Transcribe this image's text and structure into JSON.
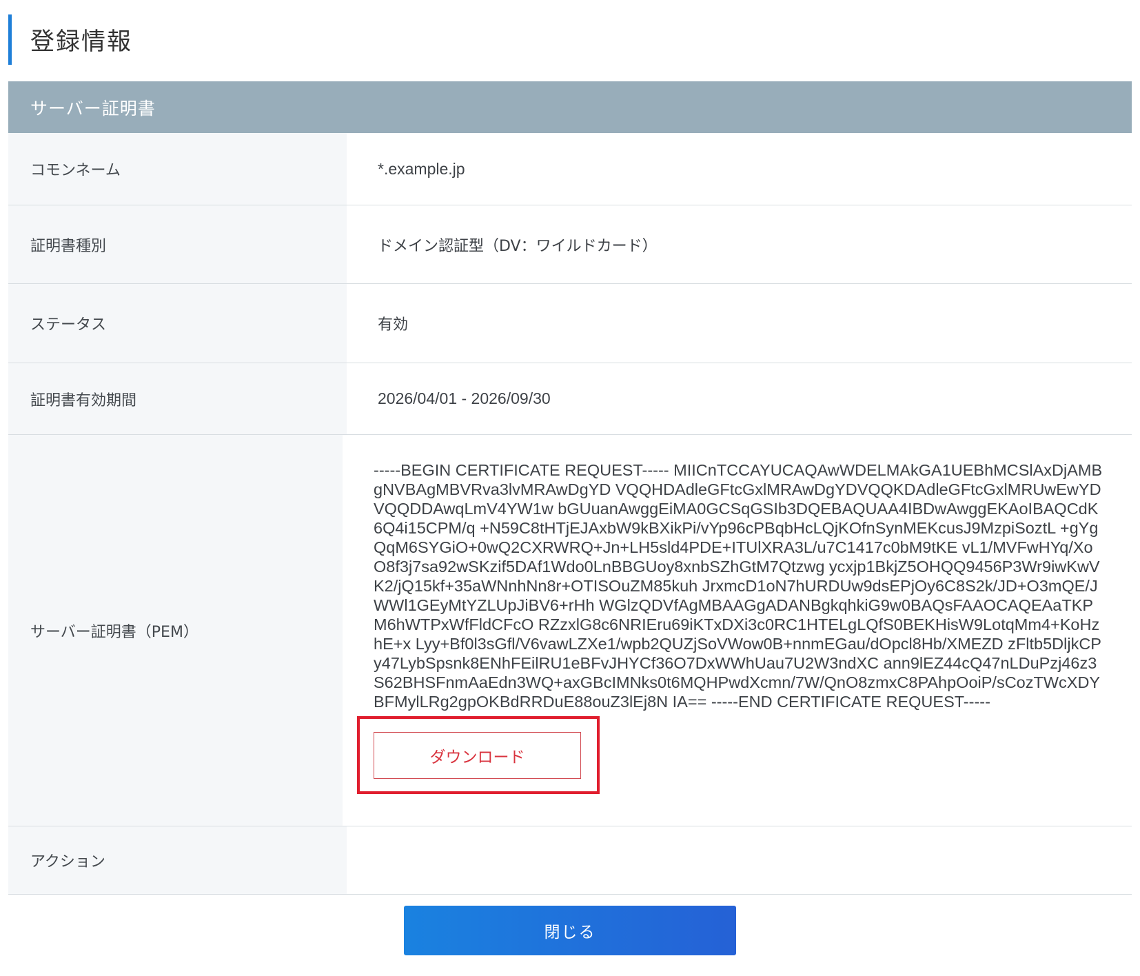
{
  "page_title": "登録情報",
  "section": {
    "title": "サーバー証明書",
    "rows": {
      "common_name": {
        "label": "コモンネーム",
        "value": "*.example.jp"
      },
      "cert_type": {
        "label": "証明書種別",
        "value": "ドメイン認証型（DV：ワイルドカード）"
      },
      "status": {
        "label": "ステータス",
        "value": "有効"
      },
      "validity": {
        "label": "証明書有効期間",
        "value": "2026/04/01 - 2026/09/30"
      },
      "pem": {
        "label": "サーバー証明書（PEM）",
        "value": "-----BEGIN CERTIFICATE REQUEST----- MIICnTCCAYUCAQAwWDELMAkGA1UEBhMCSlAxDjAMBgNVBAgMBVRva3lvMRAwDgYD VQQHDAdleGFtcGxlMRAwDgYDVQQKDAdleGFtcGxlMRUwEwYDVQQDDAwqLmV4YW1w bGUuanAwggEiMA0GCSqGSIb3DQEBAQUAA4IBDwAwggEKAoIBAQCdK6Q4i15CPM/q +N59C8tHTjEJAxbW9kBXikPi/vYp96cPBqbHcLQjKOfnSynMEKcusJ9MzpiSoztL +gYgQqM6SYGiO+0wQ2CXRWRQ+Jn+LH5sld4PDE+ITUlXRA3L/u7C1417c0bM9tKE vL1/MVFwHYq/XoO8f3j7sa92wSKzif5DAf1Wdo0LnBBGUoy8xnbSZhGtM7Qtzwg ycxjp1BkjZ5OHQQ9456P3Wr9iwKwVK2/jQ15kf+35aWNnhNn8r+OTISOuZM85kuh JrxmcD1oN7hURDUw9dsEPjOy6C8S2k/JD+O3mQE/JWWl1GEyMtYZLUpJiBV6+rHh WGlzQDVfAgMBAAGgADANBgkqhkiG9w0BAQsFAAOCAQEAaTKPM6hWTPxWfFldCFcO RZzxlG8c6NRIEru69iKTxDXi3c0RC1HTELgLQfS0BEKHisW9LotqMm4+KoHzhE+x Lyy+Bf0l3sGfl/V6vawLZXe1/wpb2QUZjSoVWow0B+nnmEGau/dOpcl8Hb/XMEZD zFltb5DljkCPy47LybSpsnk8ENhFEilRU1eBFvJHYCf36O7DxWWhUau7U2W3ndXC ann9lEZ44cQ47nLDuPzj46z3S62BHSFnmAaEdn3WQ+axGBcIMNks0t6MQHPwdXcmn/7W/QnO8zmxC8PAhpOoiP/sCozTWcXDYBFMylLRg2gpOKBdRRDuE88ouZ3lEj8N IA== -----END CERTIFICATE REQUEST-----",
        "download_label": "ダウンロード"
      },
      "action": {
        "label": "アクション",
        "value": ""
      }
    }
  },
  "footer": {
    "close_label": "閉じる"
  },
  "colors": {
    "accent": "#1f7fd8",
    "section_header_bg": "#98adba",
    "highlight_border": "#e01e2e",
    "download_text": "#d9343f",
    "close_gradient_start": "#1a82e0",
    "close_gradient_end": "#2561d6"
  }
}
